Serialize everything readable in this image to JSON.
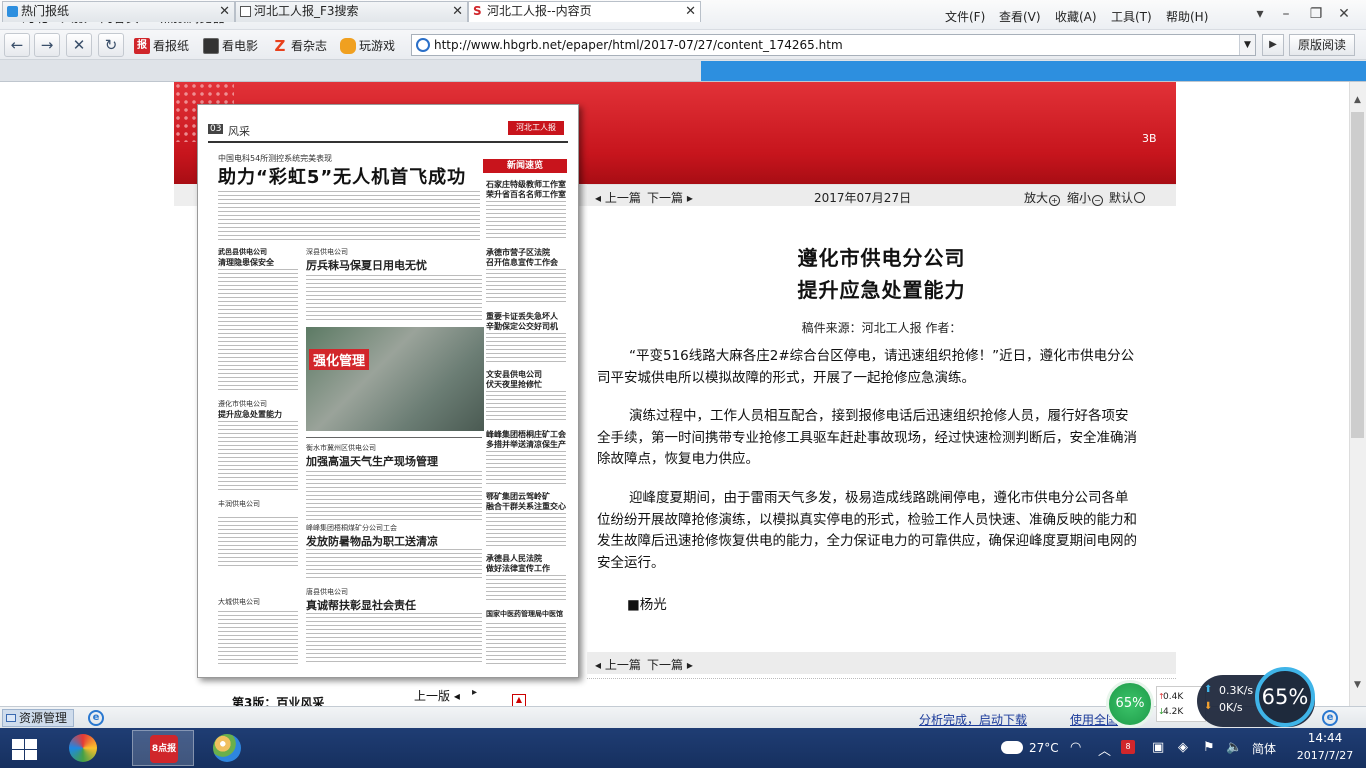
{
  "window": {
    "title": "河北工人报一内容页 - 8点报浏览器",
    "app_icon": "8dianbao-logo-icon",
    "menus": [
      "文件(F)",
      "查看(V)",
      "收藏(A)",
      "工具(T)",
      "帮助(H)"
    ]
  },
  "toolbar": {
    "quick_links": [
      {
        "label": "看报纸",
        "icon": "newspaper-icon",
        "color": "#d0262b"
      },
      {
        "label": "看电影",
        "icon": "film-icon",
        "color": "#333333"
      },
      {
        "label": "看杂志",
        "icon": "magazine-icon",
        "color": "#e8401c"
      },
      {
        "label": "玩游戏",
        "icon": "gamepad-icon",
        "color": "#f0a020"
      }
    ],
    "address": "http://www.hbgrb.net/epaper/html/2017-07/27/content_174265.htm",
    "original_view_label": "原版阅读"
  },
  "tabs": [
    {
      "label": "热门报纸",
      "active": false
    },
    {
      "label": "河北工人报_F3搜索",
      "active": false
    },
    {
      "label": "河北工人报--内容页",
      "active": true
    }
  ],
  "banner": {
    "code": "3B"
  },
  "newspaper": {
    "page_no": "03",
    "section": "风采",
    "kicker": "中国电科54所测控系统完美表现",
    "headline": "助力“彩虹5”无人机首飞成功",
    "news_box": "新闻速览",
    "photo_label": "强化管理",
    "sub_heads": [
      "武邑县供电公司",
      "清理隐患保安全",
      "深县供电公司",
      "厉兵秣马保夏日用电无忧",
      "遵化市供电公司",
      "提升应急处置能力",
      "衡水市冀州区供电公司",
      "加强高温天气生产现场管理",
      "丰润供电公司",
      "峰峰集团梧桐煤矿分公司工会",
      "发放防暑物品为职工送清凉",
      "唐县供电公司",
      "真诚帮扶彰显社会责任",
      "大城供电公司",
      "石家庄特级教师工作室",
      "荣升省百名名师工作室",
      "承德市营子区法院",
      "召开信息宣传工作会",
      "重要卡证丢失急坏人",
      "辛勤保定公交好司机",
      "文安县供电公司",
      "伏天夜里抢修忙",
      "峰峰集团梧桐庄矿工会",
      "多措并举送清凉保生产",
      "鄂矿集团云驾岭矿",
      "融合干群关系注重交心",
      "承德县人民法院",
      "做好法律宣传工作",
      "国家中医药管理局中医馆"
    ]
  },
  "article": {
    "nav_prev": "上一篇",
    "nav_next": "下一篇",
    "date": "2017年07月27日",
    "zoom_in": "放大",
    "zoom_out": "缩小",
    "zoom_default": "默认",
    "title_line1": "遵化市供电分公司",
    "title_line2": "提升应急处置能力",
    "meta": "稿件来源：河北工人报  作者：",
    "paragraphs": [
      "“平变516线路大麻各庄2#综合台区停电，请迅速组织抢修！”近日，遵化市供电分公司平安城供电所以模拟故障的形式，开展了一起抢修应急演练。",
      "演练过程中，工作人员相互配合，接到报修电话后迅速组织抢修人员，履行好各项安全手续，第一时间携带专业抢修工具驱车赶赴事故现场，经过快速检测判断后，安全准确消除故障点，恢复电力供应。",
      "迎峰度夏期间，由于雷雨天气多发，极易造成线路跳闸停电，遵化市供电分公司各单位纷纷开展故障抢修演练，以模拟真实停电的形式，检验工作人员快速、准确反映的能力和发生故障后迅速抢修恢复供电的能力，全力保证电力的可靠供应，确保迎峰度夏期间电网的安全运行。"
    ],
    "signature": "■杨光"
  },
  "page_controls": {
    "page_label": "第3版：百业风采",
    "prev_label": "上一版"
  },
  "statusbar": {
    "resource_manager": "资源管理",
    "link1": "分析完成，启动下载",
    "link2": "使用全国"
  },
  "widgets": {
    "cpu_percent": "65%",
    "mini_up": "0.4K",
    "mini_down": "4.2K",
    "upload_speed": "0.3K/s",
    "download_speed": "0K/s",
    "gauge_percent": "65%"
  },
  "taskbar": {
    "temperature": "27°C",
    "lang": "简体",
    "time": "14:44",
    "date": "2017/7/27",
    "app2_label": "8点报"
  }
}
